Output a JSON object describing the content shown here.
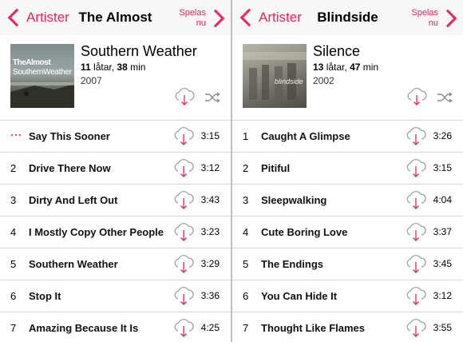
{
  "colors": {
    "accent": "#f0245a",
    "separator": "#d6d6d6"
  },
  "panels": [
    {
      "back_label": "Artister",
      "title": "The Almost",
      "now_playing": [
        "Spelas",
        "nu"
      ],
      "cover_text": [
        "TheAlmost",
        "SouthernWeather"
      ],
      "album": {
        "name": "Southern Weather",
        "track_count": "11",
        "track_word": "låtar,",
        "minutes": "38",
        "min_word": "min",
        "year": "2007"
      },
      "tracks": [
        {
          "num": "···",
          "playing": true,
          "title": "Say This Sooner",
          "duration": "3:15"
        },
        {
          "num": "2",
          "title": "Drive There Now",
          "duration": "3:12"
        },
        {
          "num": "3",
          "title": "Dirty And Left Out",
          "duration": "3:43"
        },
        {
          "num": "4",
          "title": "I Mostly Copy Other People",
          "duration": "3:23"
        },
        {
          "num": "5",
          "title": "Southern Weather",
          "duration": "3:29"
        },
        {
          "num": "6",
          "title": "Stop It",
          "duration": "3:36"
        },
        {
          "num": "7",
          "title": "Amazing Because It Is",
          "duration": "4:25"
        }
      ]
    },
    {
      "back_label": "Artister",
      "title": "Blindside",
      "now_playing": [
        "Spelas",
        "nu"
      ],
      "cover_text": [
        "blindside"
      ],
      "album": {
        "name": "Silence",
        "track_count": "13",
        "track_word": "låtar,",
        "minutes": "47",
        "min_word": "min",
        "year": "2002"
      },
      "tracks": [
        {
          "num": "1",
          "title": "Caught A Glimpse",
          "duration": "3:26"
        },
        {
          "num": "2",
          "title": "Pitiful",
          "duration": "3:15"
        },
        {
          "num": "3",
          "title": "Sleepwalking",
          "duration": "4:04"
        },
        {
          "num": "4",
          "title": "Cute Boring Love",
          "duration": "3:37"
        },
        {
          "num": "5",
          "title": "The Endings",
          "duration": "3:45"
        },
        {
          "num": "6",
          "title": "You Can Hide It",
          "duration": "3:12"
        },
        {
          "num": "7",
          "title": "Thought Like Flames",
          "duration": "3:55"
        }
      ]
    }
  ]
}
